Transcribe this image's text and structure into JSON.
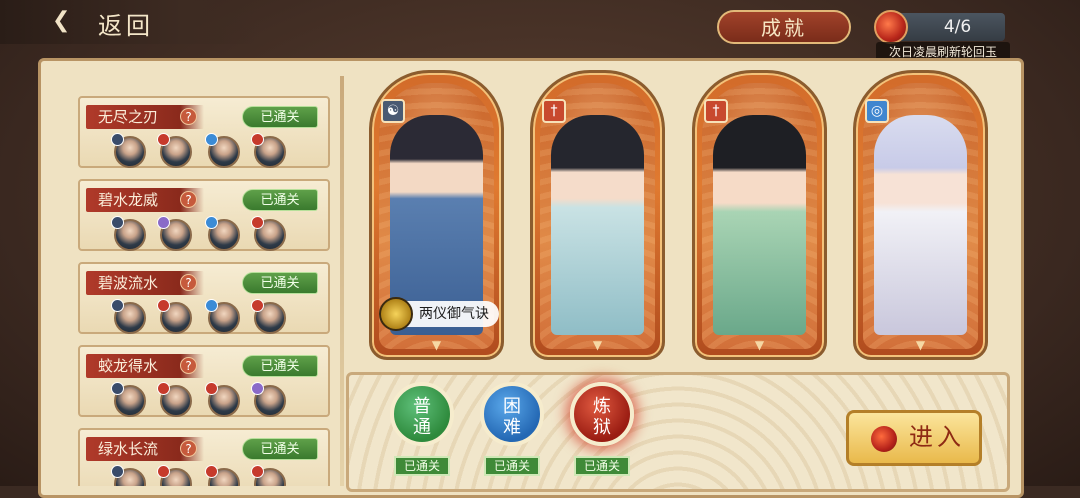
{
  "header": {
    "back_icon": "back-arrow-swirl-icon",
    "back_label": "返回",
    "achievement_label": "成就",
    "jade": {
      "icon": "reincarnation-jade-icon",
      "count": "4/6",
      "note": "次日凌晨刷新轮回玉"
    }
  },
  "stages": [
    {
      "name": "无尽之刃",
      "status": "已通关",
      "badges": [
        "tiji",
        "jian",
        "shui",
        "jian"
      ]
    },
    {
      "name": "碧水龙威",
      "status": "已通关",
      "badges": [
        "tiji",
        "zi",
        "shui",
        "jian"
      ]
    },
    {
      "name": "碧波流水",
      "status": "已通关",
      "badges": [
        "tiji",
        "jian",
        "shui",
        "jian"
      ]
    },
    {
      "name": "蛟龙得水",
      "status": "已通关",
      "badges": [
        "tiji",
        "jian",
        "jian",
        "zi"
      ]
    },
    {
      "name": "绿水长流",
      "status": "已通关",
      "badges": [
        "tiji",
        "jian",
        "jian",
        "jian"
      ]
    }
  ],
  "help_glyph": "?",
  "heroes": [
    {
      "type_icon": "taiji-icon",
      "type_glyph": "☯",
      "skill": "两仪御气诀"
    },
    {
      "type_icon": "sword-icon",
      "type_glyph": "†"
    },
    {
      "type_icon": "sword-icon",
      "type_glyph": "†"
    },
    {
      "type_icon": "water-swirl-icon",
      "type_glyph": "◎"
    }
  ],
  "difficulties": [
    {
      "label_top": "普",
      "label_bottom": "通",
      "status": "已通关",
      "color": "#2e8a3c"
    },
    {
      "label_top": "困",
      "label_bottom": "难",
      "status": "已通关",
      "color": "#2468b4"
    },
    {
      "label_top": "炼",
      "label_bottom": "狱",
      "status": "已通关",
      "color": "#9a1c12"
    }
  ],
  "enter_label": "进入",
  "colors": {
    "accent_red": "#8a2a1c",
    "cleared_green": "#3a7a2e",
    "parchment": "#efe2c2"
  }
}
